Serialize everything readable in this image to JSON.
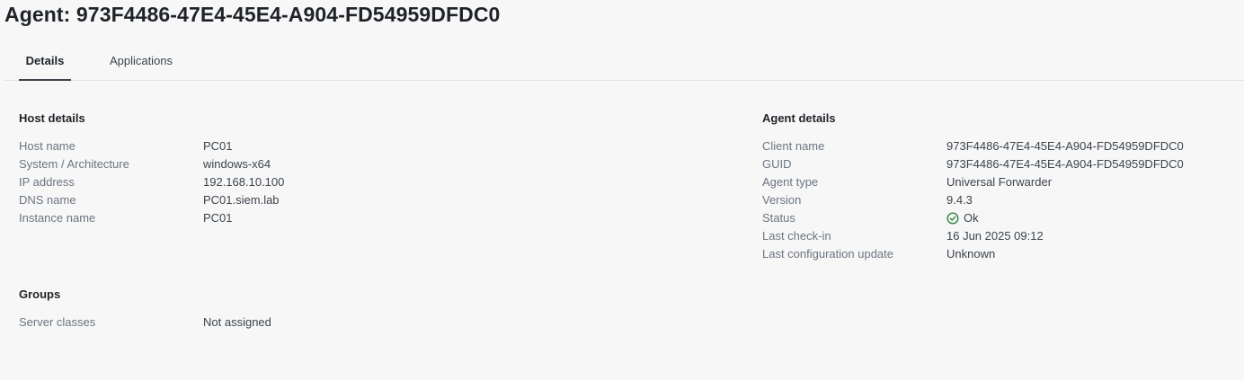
{
  "page": {
    "title": "Agent: 973F4486-47E4-45E4-A904-FD54959DFDC0"
  },
  "tabs": [
    {
      "label": "Details",
      "active": true
    },
    {
      "label": "Applications",
      "active": false
    }
  ],
  "host_details": {
    "title": "Host details",
    "rows": [
      {
        "label": "Host name",
        "value": "PC01"
      },
      {
        "label": "System / Architecture",
        "value": "windows-x64"
      },
      {
        "label": "IP address",
        "value": "192.168.10.100"
      },
      {
        "label": "DNS name",
        "value": "PC01.siem.lab"
      },
      {
        "label": "Instance name",
        "value": "PC01"
      }
    ]
  },
  "agent_details": {
    "title": "Agent details",
    "rows": [
      {
        "label": "Client name",
        "value": "973F4486-47E4-45E4-A904-FD54959DFDC0"
      },
      {
        "label": "GUID",
        "value": "973F4486-47E4-45E4-A904-FD54959DFDC0"
      },
      {
        "label": "Agent type",
        "value": "Universal Forwarder"
      },
      {
        "label": "Version",
        "value": "9.4.3"
      },
      {
        "label": "Status",
        "value": "Ok",
        "icon": "check-circle-icon",
        "color": "#2e8540"
      },
      {
        "label": "Last check-in",
        "value": "16 Jun 2025 09:12"
      },
      {
        "label": "Last configuration update",
        "value": "Unknown"
      }
    ]
  },
  "groups": {
    "title": "Groups",
    "rows": [
      {
        "label": "Server classes",
        "value": "Not assigned"
      }
    ]
  }
}
